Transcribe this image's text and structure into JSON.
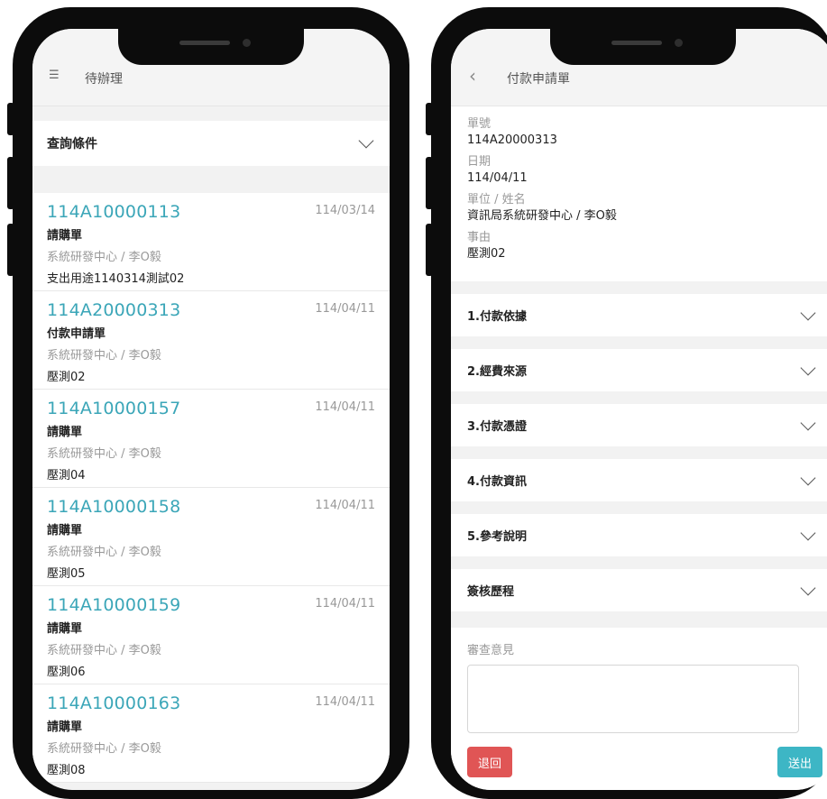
{
  "left": {
    "topbar": {
      "menu_icon": "☰",
      "title": "待辦理"
    },
    "query": {
      "label": "查詢條件"
    },
    "items": [
      {
        "no": "114A10000113",
        "date": "114/03/14",
        "form": "請購單",
        "unit": "系統研發中心 / 李O毅",
        "memo": "支出用途1140314測試02"
      },
      {
        "no": "114A20000313",
        "date": "114/04/11",
        "form": "付款申請單",
        "unit": "系統研發中心 / 李O毅",
        "memo": "壓測02"
      },
      {
        "no": "114A10000157",
        "date": "114/04/11",
        "form": "請購單",
        "unit": "系統研發中心 / 李O毅",
        "memo": "壓測04"
      },
      {
        "no": "114A10000158",
        "date": "114/04/11",
        "form": "請購單",
        "unit": "系統研發中心 / 李O毅",
        "memo": "壓測05"
      },
      {
        "no": "114A10000159",
        "date": "114/04/11",
        "form": "請購單",
        "unit": "系統研發中心 / 李O毅",
        "memo": "壓測06"
      },
      {
        "no": "114A10000163",
        "date": "114/04/11",
        "form": "請購單",
        "unit": "系統研發中心 / 李O毅",
        "memo": "壓測08"
      }
    ]
  },
  "right": {
    "topbar": {
      "back_icon": "‹",
      "title": "付款申請單"
    },
    "info": {
      "no_label": "單號",
      "no_value": "114A20000313",
      "date_label": "日期",
      "date_value": "114/04/11",
      "unit_label": "單位 / 姓名",
      "unit_value": "資訊局系統研發中心 / 李O毅",
      "reason_label": "事由",
      "reason_value": "壓測02"
    },
    "sections": [
      "1.付款依據",
      "2.經費來源",
      "3.付款憑證",
      "4.付款資訊",
      "5.參考說明",
      "簽核歷程"
    ],
    "review": {
      "label": "審查意見",
      "value": "",
      "reject": "退回",
      "submit": "送出"
    }
  },
  "colors": {
    "accent": "#3ba6b8",
    "reject": "#e05555",
    "submit": "#3db6c5"
  }
}
